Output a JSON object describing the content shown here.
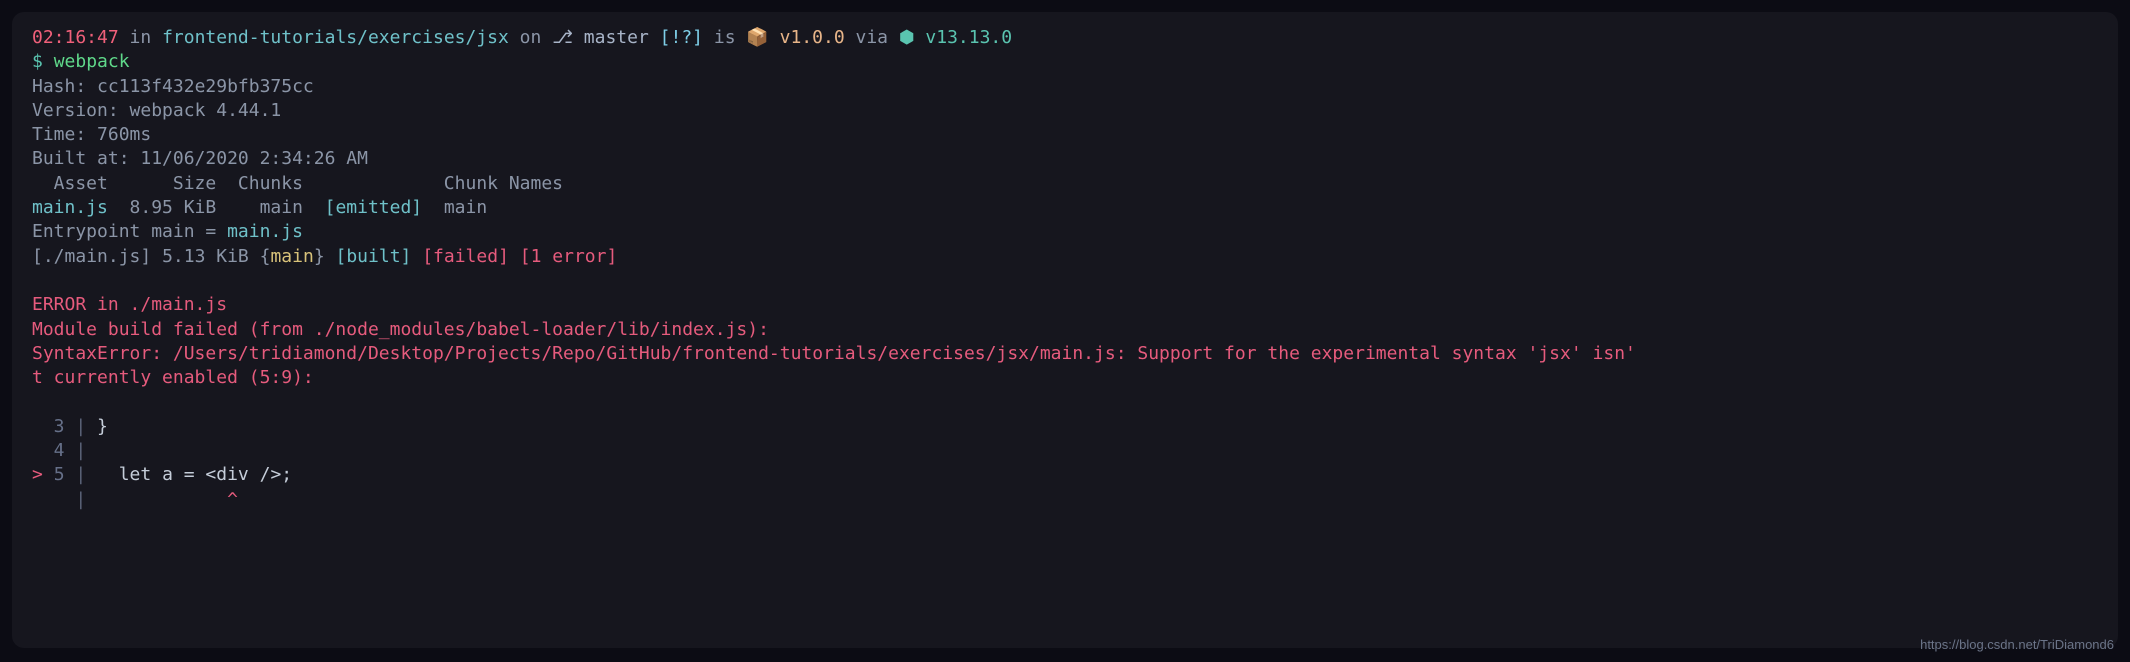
{
  "prompt": {
    "time": "02:16:47",
    "in_word": " in ",
    "path": "frontend-tutorials/exercises/jsx",
    "on_word": " on ",
    "branch_icon": "⎇",
    "branch": " master ",
    "flags": "[!?]",
    "is_word": " is ",
    "pkg_icon": "📦",
    "pkg_version": " v1.0.0",
    "via_word": " via ",
    "node_icon": "⬢",
    "node_version": " v13.13.0"
  },
  "command": {
    "prompt_symbol": "$ ",
    "cmd": "webpack"
  },
  "output": {
    "hash_label": "Hash: ",
    "hash_value": "cc113f432e29bfb375cc",
    "version_label": "Version: ",
    "version_value": "webpack 4.44.1",
    "time_label": "Time: ",
    "time_value": "760ms",
    "built_label": "Built at: ",
    "built_value": "11/06/2020 2:34:26 AM",
    "table_header": "  Asset      Size  Chunks             Chunk Names",
    "asset_name": "main.js",
    "asset_size": "  8.95 KiB    ",
    "asset_chunk": "main",
    "asset_emitted": "  [emitted]  ",
    "asset_chunkname": "main",
    "entrypoint_label": "Entrypoint ",
    "entrypoint_name": "main",
    "entrypoint_eq": " = ",
    "entrypoint_file": "main.js",
    "module_bracket_open": "[",
    "module_file": "./main.js",
    "module_bracket_close": "] ",
    "module_size": "5.13 KiB ",
    "module_brace_open": "{",
    "module_chunk": "main",
    "module_brace_close": "}",
    "module_built": " [built]",
    "module_failed": " [failed]",
    "module_errors": " [1 error]"
  },
  "error": {
    "line1": "ERROR in ./main.js",
    "line2": "Module build failed (from ./node_modules/babel-loader/lib/index.js):",
    "line3a": "SyntaxError: /Users/tridiamond/Desktop/Projects/Repo/GitHub/frontend-tutorials/exercises/jsx/main.js: Support for the experimental syntax 'jsx' isn'",
    "line3b": "t currently enabled (5:9):",
    "code_l3_num": "  3",
    "code_l3_pipe": " | ",
    "code_l3_text": "}",
    "code_l4_num": "  4",
    "code_l4_pipe": " | ",
    "code_l5_marker": "> ",
    "code_l5_num": "5",
    "code_l5_pipe": " | ",
    "code_l5_text": "  let a = <div />;",
    "caret_pipe": "    | ",
    "caret_line": "            ^"
  },
  "watermark": "https://blog.csdn.net/TriDiamond6"
}
